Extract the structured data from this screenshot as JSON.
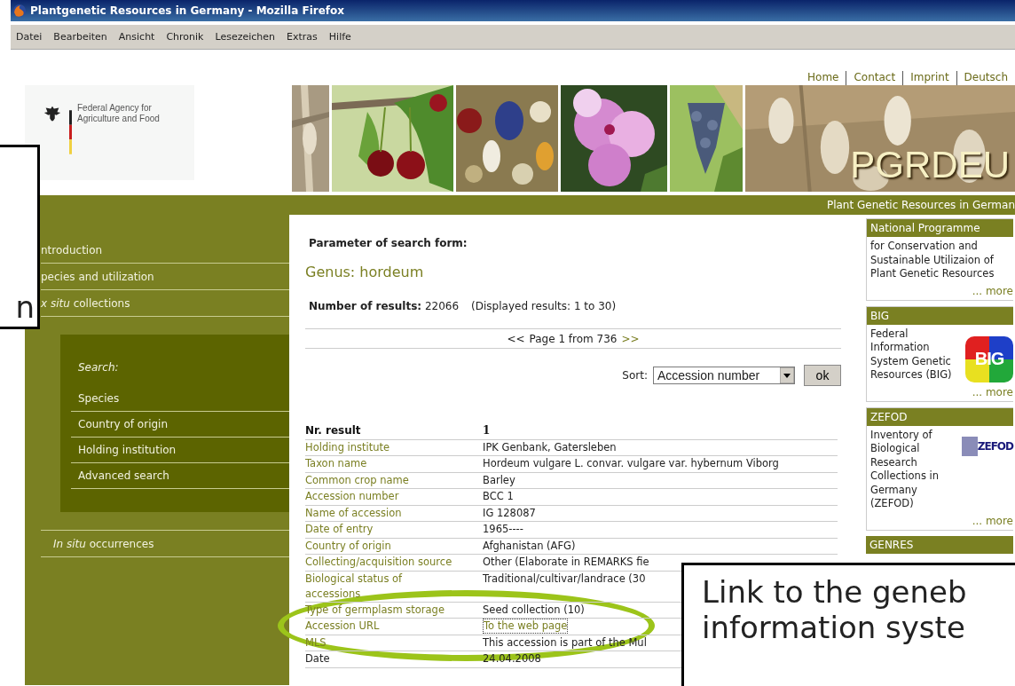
{
  "window": {
    "title": "Plantgenetic Resources in Germany - Mozilla Firefox"
  },
  "menu": [
    "Datei",
    "Bearbeiten",
    "Ansicht",
    "Chronik",
    "Lesezeichen",
    "Extras",
    "Hilfe"
  ],
  "top_links": [
    "Home",
    "Contact",
    "Imprint",
    "Deutsch"
  ],
  "agency": {
    "lines": [
      "Federal Agency for",
      "Agriculture and Food"
    ]
  },
  "banner": {
    "logo": "PGRDEU",
    "tagline": "Plant Genetic Resources in German"
  },
  "sidebar": {
    "items": [
      {
        "label": "ntroduction"
      },
      {
        "label": "pecies and utilization"
      },
      {
        "label": "*x situ* collections"
      }
    ],
    "search": {
      "title": "Search:",
      "items": [
        "Species",
        "Country of origin",
        "Holding institution",
        "Advanced search"
      ]
    },
    "items_after": [
      {
        "label": "*In situ* occurrences"
      }
    ]
  },
  "main": {
    "heading": "Parameter of search form:",
    "genus": "Genus: hordeum",
    "results_label": "Number of results:",
    "results_count": "22066",
    "displayed": "(Displayed results: 1 to 30)",
    "pager": {
      "prev": "<<",
      "text": "Page 1 from 736",
      "next": ">>"
    },
    "sort": {
      "label": "Sort:",
      "value": "Accession number",
      "button": "ok"
    },
    "table": {
      "header": [
        "Nr. result",
        "1"
      ],
      "rows": [
        {
          "kind": "field",
          "label": "Holding institute",
          "value": "IPK Genbank, Gatersleben"
        },
        {
          "kind": "field",
          "label": "Taxon name",
          "value": "Hordeum vulgare L. convar. vulgare var. hybernum Viborg"
        },
        {
          "kind": "field",
          "label": "Common crop name",
          "value": "Barley"
        },
        {
          "kind": "field",
          "label": "Accession number",
          "value": "BCC 1"
        },
        {
          "kind": "field",
          "label": "Name of accession",
          "value": "IG 128087"
        },
        {
          "kind": "field",
          "label": "Date of entry",
          "value": "1965----"
        },
        {
          "kind": "field",
          "label": "Country of origin",
          "value": "Afghanistan (AFG)"
        },
        {
          "kind": "field",
          "label": "Collecting/acquisition source",
          "value": "Other (Elaborate in REMARKS fie"
        },
        {
          "kind": "field",
          "label": "Biological status of accessions",
          "value": "Traditional/cultivar/landrace (30"
        },
        {
          "kind": "field",
          "label": "Type of germplasm storage",
          "value": "Seed collection (10)"
        },
        {
          "kind": "link",
          "label": "Accession URL",
          "value": "To the web page"
        },
        {
          "kind": "field",
          "label": "MLS",
          "value": "This accession is part of the Mul"
        },
        {
          "kind": "meta",
          "label": "Date",
          "value": "24.04.2008"
        }
      ]
    }
  },
  "panels": [
    {
      "title": "National Programme",
      "text": "for Conservation and Sustainable Utilizaion of Plant Genetic Resources",
      "more": "... more"
    },
    {
      "title": "BIG",
      "text": "Federal Information System Genetic Resources (BIG)",
      "more": "... more",
      "logo": {
        "kind": "big",
        "text": "BIG"
      }
    },
    {
      "title": "ZEFOD",
      "text": "Inventory of Biological Research Collections in Germany (ZEFOD)",
      "more": "... more",
      "logo": {
        "kind": "zefod",
        "text": "ZEFOD"
      }
    },
    {
      "title": "GENRES"
    }
  ],
  "callouts": [
    {
      "kind": "left",
      "lines": [
        "n"
      ]
    },
    {
      "kind": "bottom",
      "lines": [
        "Link to the geneb",
        "information syste"
      ]
    }
  ]
}
